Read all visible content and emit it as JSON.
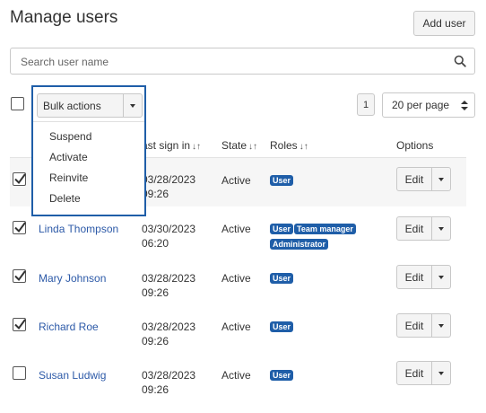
{
  "page": {
    "title": "Manage users"
  },
  "toolbar": {
    "add_user_label": "Add user"
  },
  "search": {
    "placeholder": "Search user name",
    "icon": "search-icon"
  },
  "bulk": {
    "label": "Bulk actions",
    "menu": [
      "Suspend",
      "Activate",
      "Reinvite",
      "Delete"
    ]
  },
  "pagination": {
    "current_page": "1",
    "per_page": "20 per page"
  },
  "table": {
    "headers": {
      "last_sign_in": "ast sign in",
      "state": "State",
      "roles": "Roles",
      "options": "Options"
    },
    "sort_glyph": "↓↑",
    "rows": [
      {
        "name": "",
        "date": "03/28/2023",
        "time": "09:26",
        "state": "Active",
        "roles": [
          "User"
        ],
        "checked": true
      },
      {
        "name": "Linda Thompson",
        "date": "03/30/2023",
        "time": "06:20",
        "state": "Active",
        "roles": [
          "User",
          "Team manager",
          "Administrator"
        ],
        "checked": true
      },
      {
        "name": "Mary Johnson",
        "date": "03/28/2023",
        "time": "09:26",
        "state": "Active",
        "roles": [
          "User"
        ],
        "checked": true
      },
      {
        "name": "Richard Roe",
        "date": "03/28/2023",
        "time": "09:26",
        "state": "Active",
        "roles": [
          "User"
        ],
        "checked": true
      },
      {
        "name": "Susan Ludwig",
        "date": "03/28/2023",
        "time": "09:26",
        "state": "Active",
        "roles": [
          "User"
        ],
        "checked": false
      }
    ],
    "edit_label": "Edit"
  },
  "colors": {
    "accent": "#1f5ea8",
    "link": "#2d5aa8",
    "highlight_border": "#1f5ea8"
  }
}
